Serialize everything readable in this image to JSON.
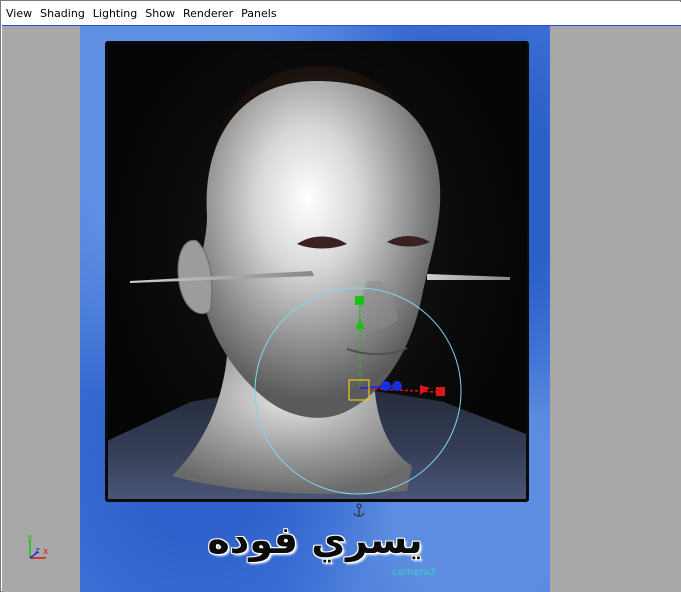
{
  "menubar": {
    "items": [
      "View",
      "Shading",
      "Lighting",
      "Show",
      "Renderer",
      "Panels"
    ]
  },
  "viewport": {
    "caption": "يسري فوده",
    "camera_label": "camera2",
    "axis": {
      "y": "y",
      "z": "z",
      "x": "x"
    }
  },
  "colors": {
    "viewport_bg": "#a8a8a8",
    "image_plane_blue": "#4275d8",
    "manipulator_ring": "#7fd8ee",
    "x_axis": "#d81818",
    "y_axis": "#18c018",
    "z_axis": "#1a2ee0",
    "pivot_box": "#e0c020"
  }
}
